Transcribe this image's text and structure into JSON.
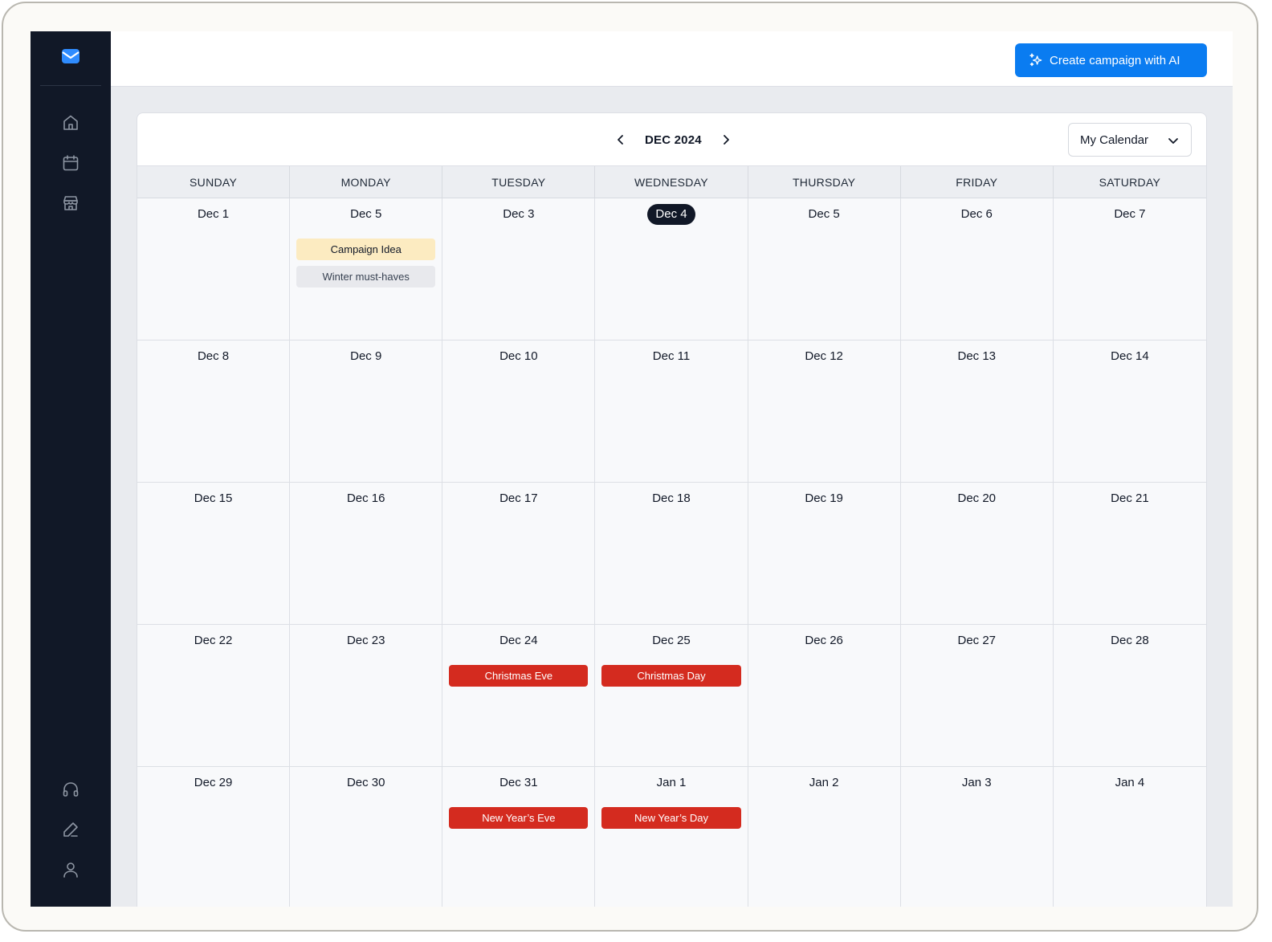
{
  "header": {
    "ai_button_label": "Create campaign with AI"
  },
  "calendar": {
    "month_label": "DEC 2024",
    "selector_value": "My Calendar",
    "weekdays": [
      "SUNDAY",
      "MONDAY",
      "TUESDAY",
      "WEDNESDAY",
      "THURSDAY",
      "FRIDAY",
      "SATURDAY"
    ],
    "days": [
      {
        "label": "Dec 1"
      },
      {
        "label": "Dec 5",
        "events": [
          {
            "title": "Campaign Idea",
            "kind": "idea"
          },
          {
            "title": "Winter must-haves",
            "kind": "neutral"
          }
        ]
      },
      {
        "label": "Dec 3"
      },
      {
        "label": "Dec 4",
        "today": true
      },
      {
        "label": "Dec 5"
      },
      {
        "label": "Dec 6"
      },
      {
        "label": "Dec 7"
      },
      {
        "label": "Dec 8"
      },
      {
        "label": "Dec 9"
      },
      {
        "label": "Dec 10"
      },
      {
        "label": "Dec 11"
      },
      {
        "label": "Dec 12"
      },
      {
        "label": "Dec 13"
      },
      {
        "label": "Dec 14"
      },
      {
        "label": "Dec 15"
      },
      {
        "label": "Dec 16"
      },
      {
        "label": "Dec 17"
      },
      {
        "label": "Dec 18"
      },
      {
        "label": "Dec 19"
      },
      {
        "label": "Dec 20"
      },
      {
        "label": "Dec 21"
      },
      {
        "label": "Dec 22"
      },
      {
        "label": "Dec 23"
      },
      {
        "label": "Dec 24",
        "events": [
          {
            "title": "Christmas Eve",
            "kind": "holiday"
          }
        ]
      },
      {
        "label": "Dec 25",
        "events": [
          {
            "title": "Christmas Day",
            "kind": "holiday"
          }
        ]
      },
      {
        "label": "Dec 26"
      },
      {
        "label": "Dec 27"
      },
      {
        "label": "Dec 28"
      },
      {
        "label": "Dec 29"
      },
      {
        "label": "Dec 30"
      },
      {
        "label": "Dec 31",
        "events": [
          {
            "title": "New Year’s Eve",
            "kind": "holiday"
          }
        ]
      },
      {
        "label": "Jan 1",
        "events": [
          {
            "title": "New Year’s Day",
            "kind": "holiday"
          }
        ]
      },
      {
        "label": "Jan 2"
      },
      {
        "label": "Jan 3"
      },
      {
        "label": "Jan 4"
      }
    ]
  },
  "sidebar": {
    "top_items": [
      "home-icon",
      "calendar-icon",
      "store-icon"
    ],
    "bottom_items": [
      "headset-icon",
      "pen-icon",
      "user-icon"
    ]
  },
  "colors": {
    "sidebar": "#111827",
    "accent": "#0a7cf1",
    "holiday": "#d42b1f",
    "idea": "#fcebc1"
  }
}
